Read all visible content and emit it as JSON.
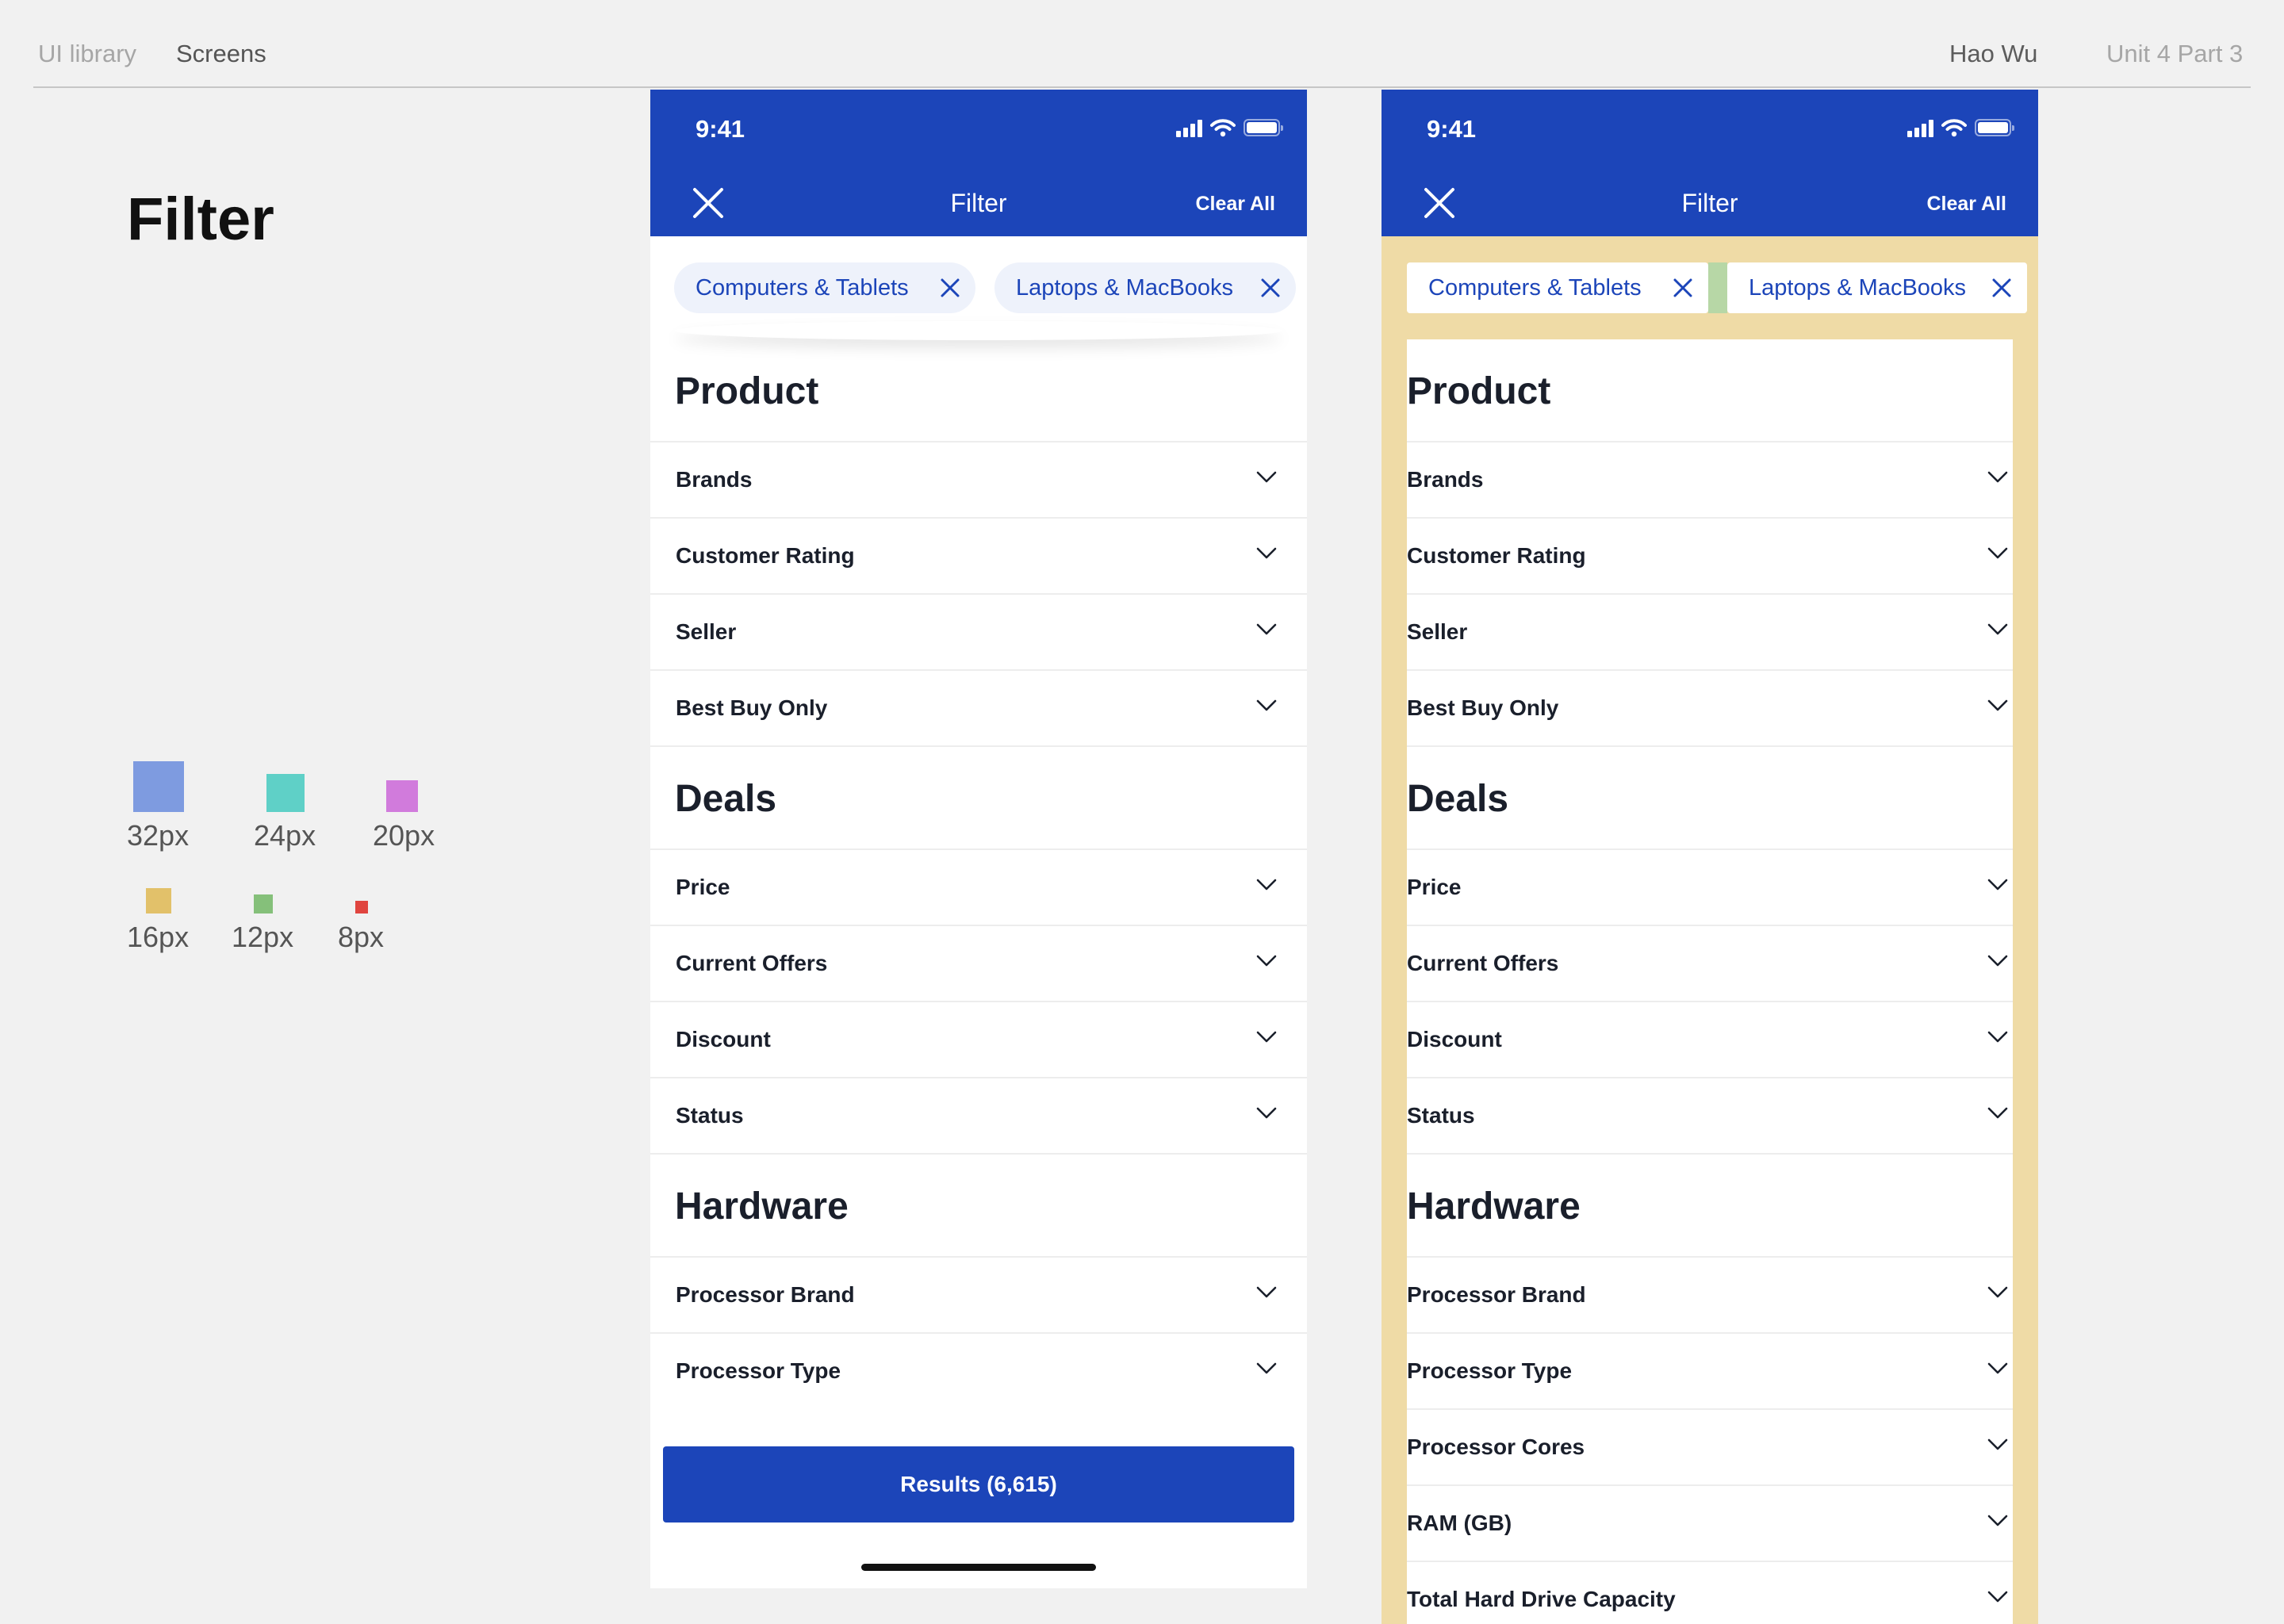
{
  "topbar": {
    "tabs": [
      "UI library",
      "Screens"
    ],
    "author": "Hao Wu",
    "unit": "Unit 4 Part 3"
  },
  "left_panel": {
    "title": "Filter",
    "legend": [
      {
        "label": "32px",
        "color": "#7e9be0"
      },
      {
        "label": "24px",
        "color": "#5fd0c7"
      },
      {
        "label": "20px",
        "color": "#d17bdc"
      },
      {
        "label": "16px",
        "color": "#e2c16a"
      },
      {
        "label": "12px",
        "color": "#85c07a"
      },
      {
        "label": "8px",
        "color": "#e0453f"
      }
    ]
  },
  "colors": {
    "brand_blue": "#1c45b9",
    "chip_bg": "#eef2fb",
    "spacing_overlay_yellow": "#efdba6",
    "spacing_overlay_green": "#b7d7a6"
  },
  "screens": [
    {
      "status_time": "9:41",
      "header": {
        "title": "Filter",
        "clear_all": "Clear All",
        "close_icon": "close-icon"
      },
      "chips": [
        "Computers & Tablets",
        "Laptops & MacBooks"
      ],
      "sections": [
        {
          "title": "Product",
          "items": [
            "Brands",
            "Customer Rating",
            "Seller",
            "Best Buy Only"
          ]
        },
        {
          "title": "Deals",
          "items": [
            "Price",
            "Current Offers",
            "Discount",
            "Status"
          ]
        },
        {
          "title": "Hardware",
          "items": [
            "Processor Brand",
            "Processor Type"
          ]
        }
      ],
      "results_button": "Results (6,615)"
    },
    {
      "status_time": "9:41",
      "header": {
        "title": "Filter",
        "clear_all": "Clear All",
        "close_icon": "close-icon"
      },
      "chips": [
        "Computers & Tablets",
        "Laptops & MacBooks"
      ],
      "sections": [
        {
          "title": "Product",
          "items": [
            "Brands",
            "Customer Rating",
            "Seller",
            "Best Buy Only"
          ]
        },
        {
          "title": "Deals",
          "items": [
            "Price",
            "Current Offers",
            "Discount",
            "Status"
          ]
        },
        {
          "title": "Hardware",
          "items": [
            "Processor Brand",
            "Processor Type",
            "Processor Cores",
            "RAM (GB)",
            "Total Hard Drive Capacity"
          ]
        }
      ]
    }
  ]
}
